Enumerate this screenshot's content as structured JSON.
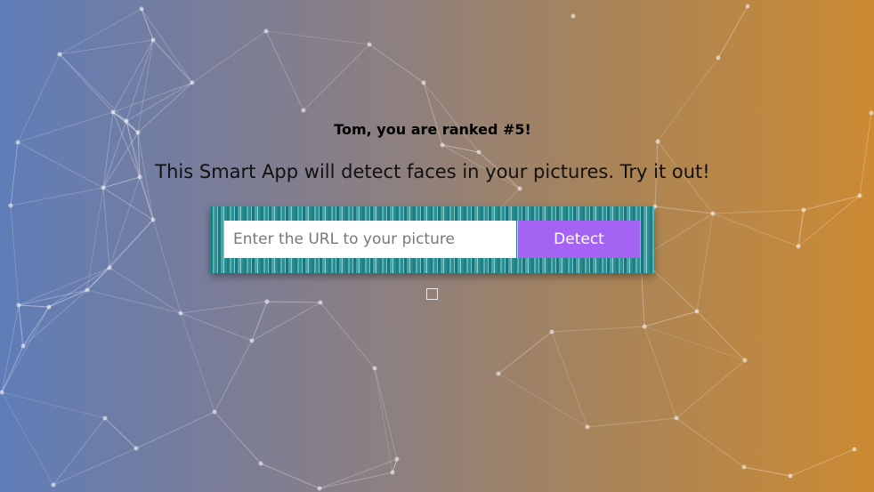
{
  "user": {
    "rank_message": "Tom, you are ranked #5!"
  },
  "app": {
    "tagline": "This Smart App will detect faces in your pictures. Try it out!"
  },
  "form": {
    "url_placeholder": "Enter the URL to your picture",
    "url_value": "",
    "detect_label": "Detect"
  },
  "colors": {
    "background_left": "#5f7db8",
    "background_right": "#cc8a32",
    "button": "#a463f2",
    "panel_pattern": "#1f7f86"
  },
  "icons": {
    "image_placeholder": "broken-image-icon"
  }
}
